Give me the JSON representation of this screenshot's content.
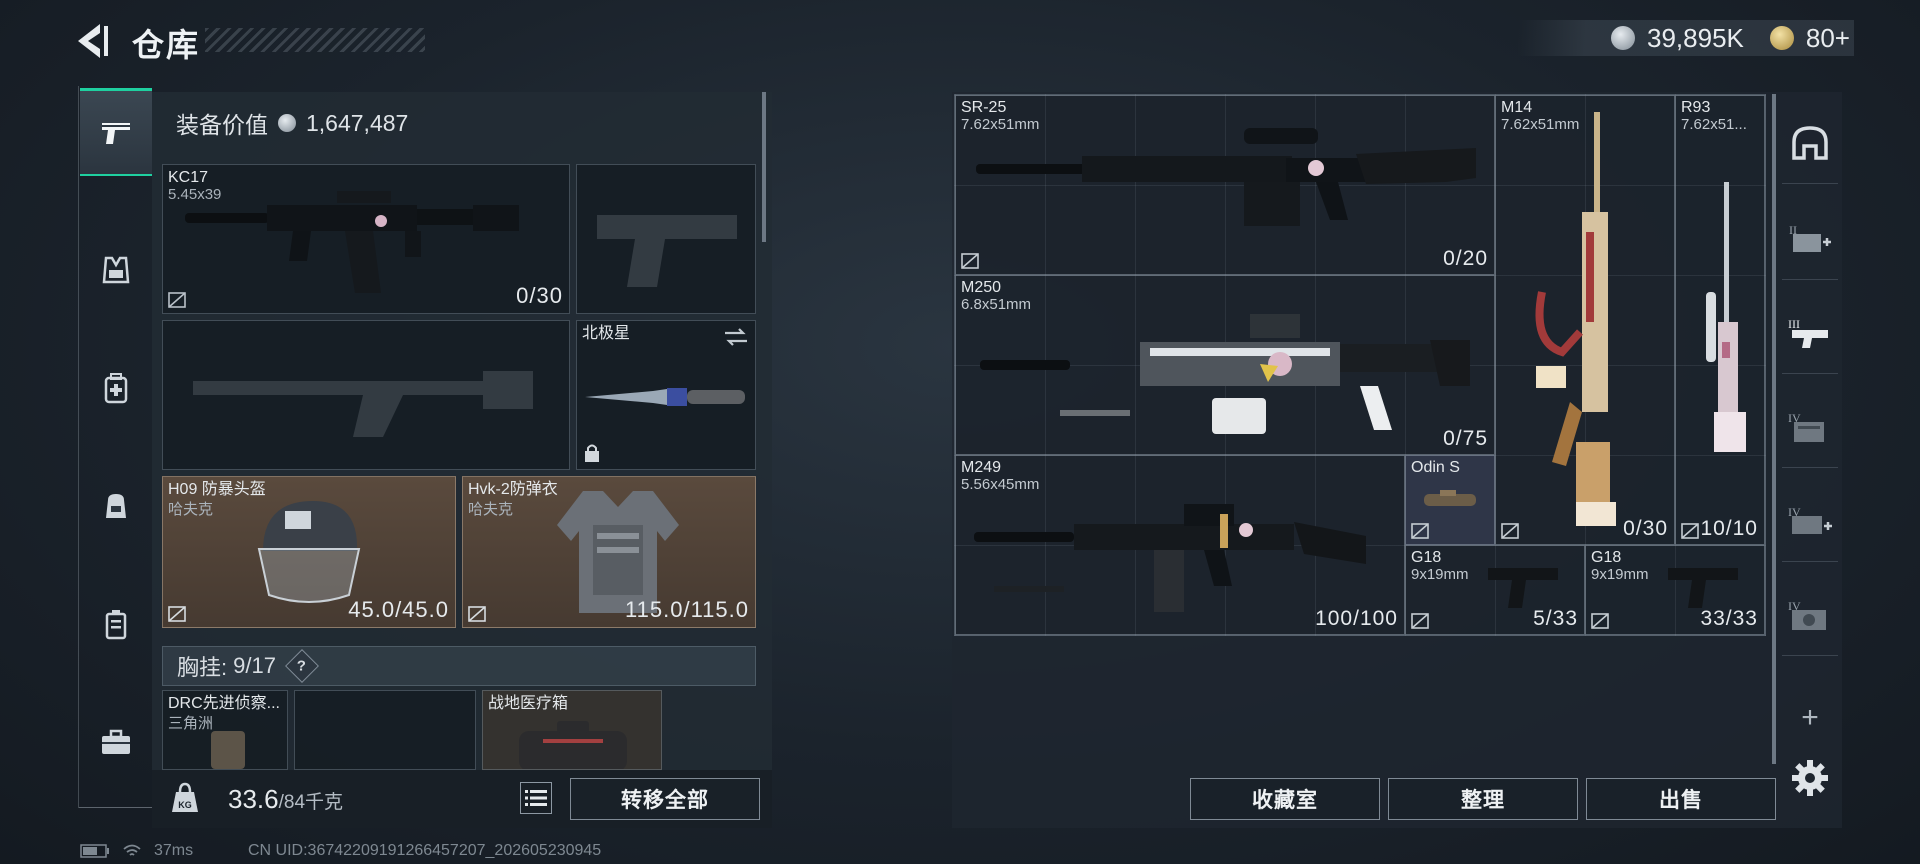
{
  "header": {
    "title": "仓库",
    "currency_silver": "39,895K",
    "currency_gold": "80+"
  },
  "left_tabs": [
    {
      "icon": "pistol-icon",
      "active": true
    },
    {
      "icon": "vest-icon",
      "active": false
    },
    {
      "icon": "backpack-medic-icon",
      "active": false
    },
    {
      "icon": "backpack-icon",
      "active": false
    },
    {
      "icon": "case-icon",
      "active": false
    },
    {
      "icon": "toolbox-icon",
      "active": false
    }
  ],
  "loadout": {
    "value_label": "装备价值",
    "value": "1,647,487",
    "primary": {
      "name": "KC17",
      "caliber": "5.45x39",
      "ammo": "0/30"
    },
    "melee": {
      "name": "北极星"
    },
    "helmet": {
      "name": "H09 防暴头盔",
      "brand": "哈夫克",
      "durability": "45.0/45.0"
    },
    "armor": {
      "name": "Hvk-2防弹衣",
      "brand": "哈夫克",
      "durability": "115.0/115.0"
    },
    "chest_rig_label": "胸挂:",
    "chest_rig_count": "9/17",
    "chest_rig_help": "?",
    "rig_items": [
      {
        "name": "DRC先进侦察...",
        "brand": "三角洲"
      },
      {
        "name": ""
      },
      {
        "name": "战地医疗箱"
      }
    ],
    "weight_value": "33.6",
    "weight_max": "/84千克",
    "weight_badge": "KG",
    "transfer_all": "转移全部"
  },
  "stash": {
    "items": [
      {
        "name": "SR-25",
        "caliber": "7.62x51mm",
        "ammo": "0/20"
      },
      {
        "name": "M250",
        "caliber": "6.8x51mm",
        "ammo": "0/75"
      },
      {
        "name": "M249",
        "caliber": "5.56x45mm",
        "ammo": "100/100"
      },
      {
        "name": "M14",
        "caliber": "7.62x51mm",
        "ammo": "0/30"
      },
      {
        "name": "R93",
        "caliber": "7.62x51...",
        "ammo": "10/10"
      },
      {
        "name": "Odin S"
      },
      {
        "name": "G18",
        "caliber": "9x19mm",
        "ammo": "5/33"
      },
      {
        "name": "G18",
        "caliber": "9x19mm",
        "ammo": "33/33"
      }
    ],
    "right_tabs": [
      "shelter-icon",
      "tier-2-box-icon",
      "tier-3-weapon-icon",
      "tier-4-folder-icon",
      "tier-4-medkit-icon",
      "tier-4-camera-icon"
    ],
    "add_tab": "+",
    "buttons": {
      "collection": "收藏室",
      "sort": "整理",
      "sell": "出售"
    }
  },
  "status": {
    "ping": "37ms",
    "uid": "CN UID:36742209191266457207_202605230945"
  },
  "colors": {
    "accent": "#1fd0a0",
    "armor_slot": "#5a4a3d"
  }
}
